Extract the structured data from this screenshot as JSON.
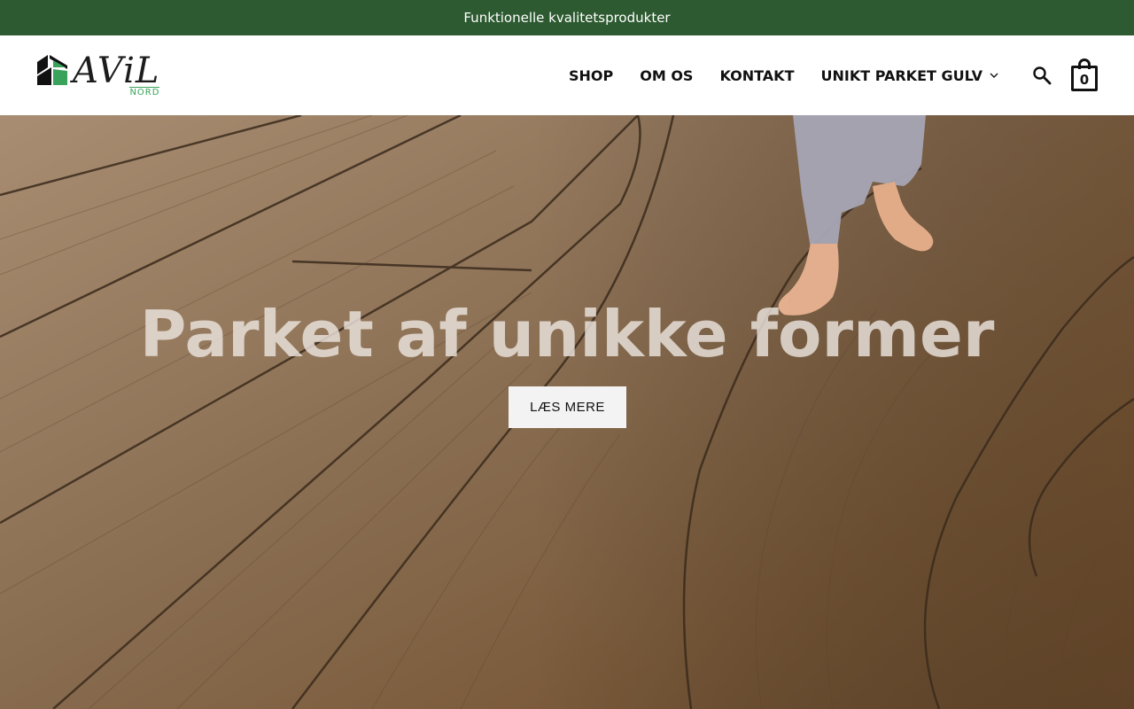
{
  "topbar": {
    "text": "Funktionelle kvalitetsprodukter"
  },
  "logo": {
    "word": "AViL",
    "sub": "NORD"
  },
  "nav": {
    "items": [
      {
        "label": "SHOP"
      },
      {
        "label": "OM OS"
      },
      {
        "label": "KONTAKT"
      },
      {
        "label": "UNIKT PARKET GULV"
      }
    ]
  },
  "header_icons": {
    "search": "search-icon",
    "cart": "shopping-bag-icon",
    "cart_count": "0"
  },
  "hero": {
    "title": "Parket af unikke former",
    "button_label": "LÆS MERE"
  },
  "colors": {
    "topbar_bg": "#2d5a30",
    "logo_green": "#3aa35b",
    "wood_light": "#9c8064",
    "wood_dark": "#6b5039"
  }
}
